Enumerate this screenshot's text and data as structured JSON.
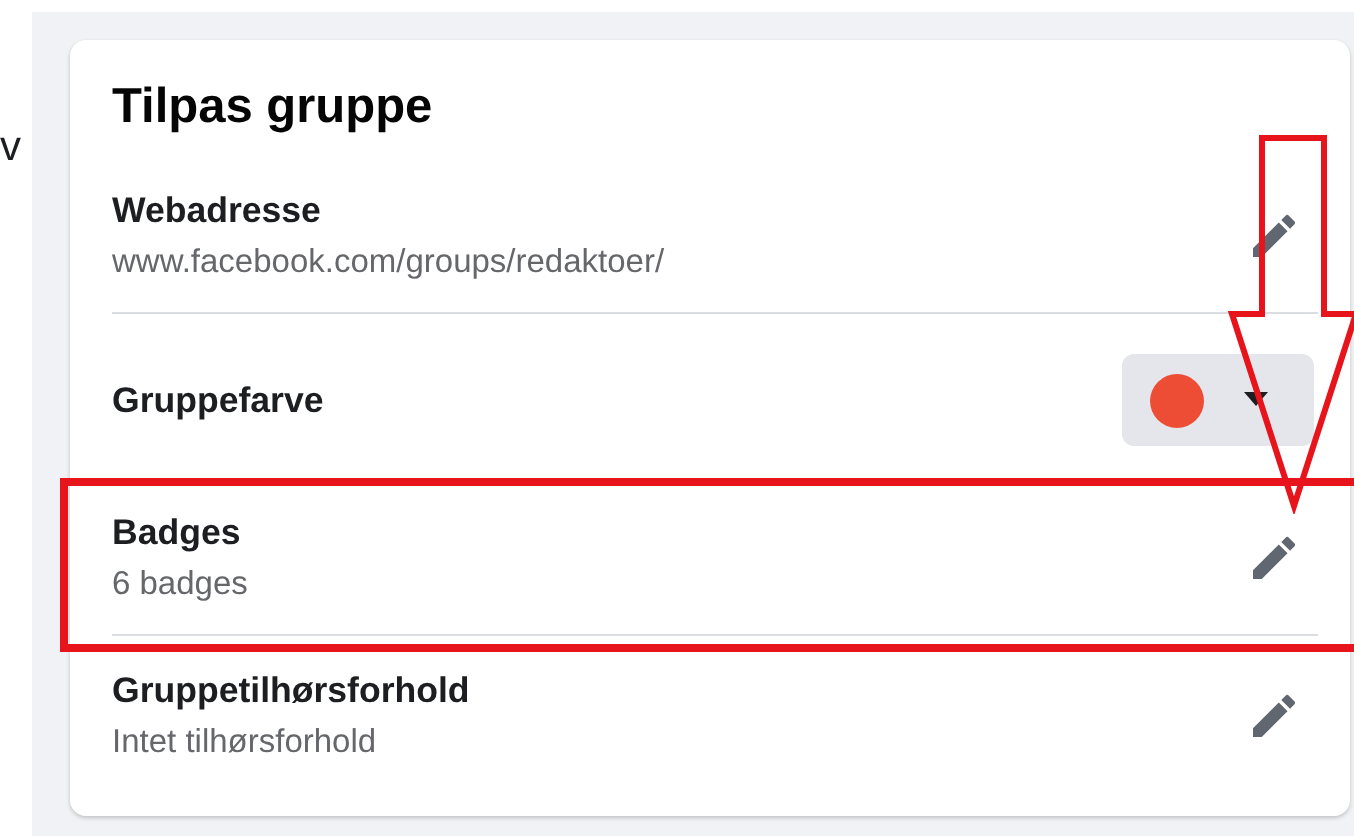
{
  "edge_text": "v",
  "card": {
    "title": "Tilpas gruppe",
    "rows": [
      {
        "kind": "edit",
        "label": "Webadresse",
        "value": "www.facebook.com/groups/redaktoer/",
        "divider": true,
        "highlighted": false
      },
      {
        "kind": "color",
        "label": "Gruppefarve",
        "color": "#ee4d35",
        "divider": false,
        "highlighted": false
      },
      {
        "kind": "edit",
        "label": "Badges",
        "value": "6 badges",
        "divider": true,
        "highlighted": true
      },
      {
        "kind": "edit",
        "label": "Gruppetilhørsforhold",
        "value": "Intet tilhørsforhold",
        "divider": false,
        "highlighted": false
      }
    ]
  },
  "annotations": [
    {
      "kind": "down-arrow"
    }
  ]
}
